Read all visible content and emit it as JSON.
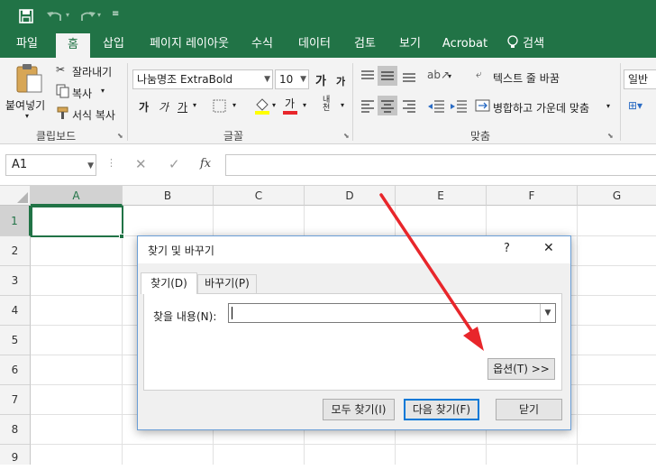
{
  "quick_access": {
    "save_icon": "save-icon",
    "undo_icon": "undo-icon",
    "redo_icon": "redo-icon",
    "customize_icon": "customize-icon"
  },
  "tabs": [
    {
      "label": "파일"
    },
    {
      "label": "홈"
    },
    {
      "label": "삽입"
    },
    {
      "label": "페이지 레이아웃"
    },
    {
      "label": "수식"
    },
    {
      "label": "데이터"
    },
    {
      "label": "검토"
    },
    {
      "label": "보기"
    },
    {
      "label": "Acrobat"
    }
  ],
  "search": {
    "label": "검색"
  },
  "clipboard": {
    "paste": "붙여넣기",
    "cut": "잘라내기",
    "copy": "복사",
    "format_painter": "서식 복사",
    "group": "클립보드"
  },
  "font": {
    "name": "나눔명조 ExtraBold",
    "size": "10",
    "bold": "가",
    "italic": "가",
    "underline": "가",
    "grow": "가",
    "shrink": "가",
    "font_color": "가",
    "phonetic": "내천",
    "group": "글꼴"
  },
  "alignment": {
    "wrap_text": "텍스트 줄 바꿈",
    "merge_center": "병합하고 가운데 맞춤",
    "group": "맞춤"
  },
  "number": {
    "format": "일반"
  },
  "formula_bar": {
    "name_box": "A1",
    "fx": "fx"
  },
  "columns": [
    "A",
    "B",
    "C",
    "D",
    "E",
    "F",
    "G"
  ],
  "rows": [
    "1",
    "2",
    "3",
    "4",
    "5",
    "6",
    "7",
    "8",
    "9"
  ],
  "dialog": {
    "title": "찾기 및 바꾸기",
    "help": "?",
    "close": "✕",
    "tab_find": "찾기(D)",
    "tab_replace": "바꾸기(P)",
    "find_label": "찾을 내용(N):",
    "find_value": "",
    "options_button": "옵션(T) >>",
    "find_all": "모두 찾기(I)",
    "find_next": "다음 찾기(F)",
    "close_button": "닫기"
  },
  "colors": {
    "excel_green": "#217346",
    "annotation_arrow": "#e8262b",
    "dialog_border": "#6a9ed6"
  }
}
